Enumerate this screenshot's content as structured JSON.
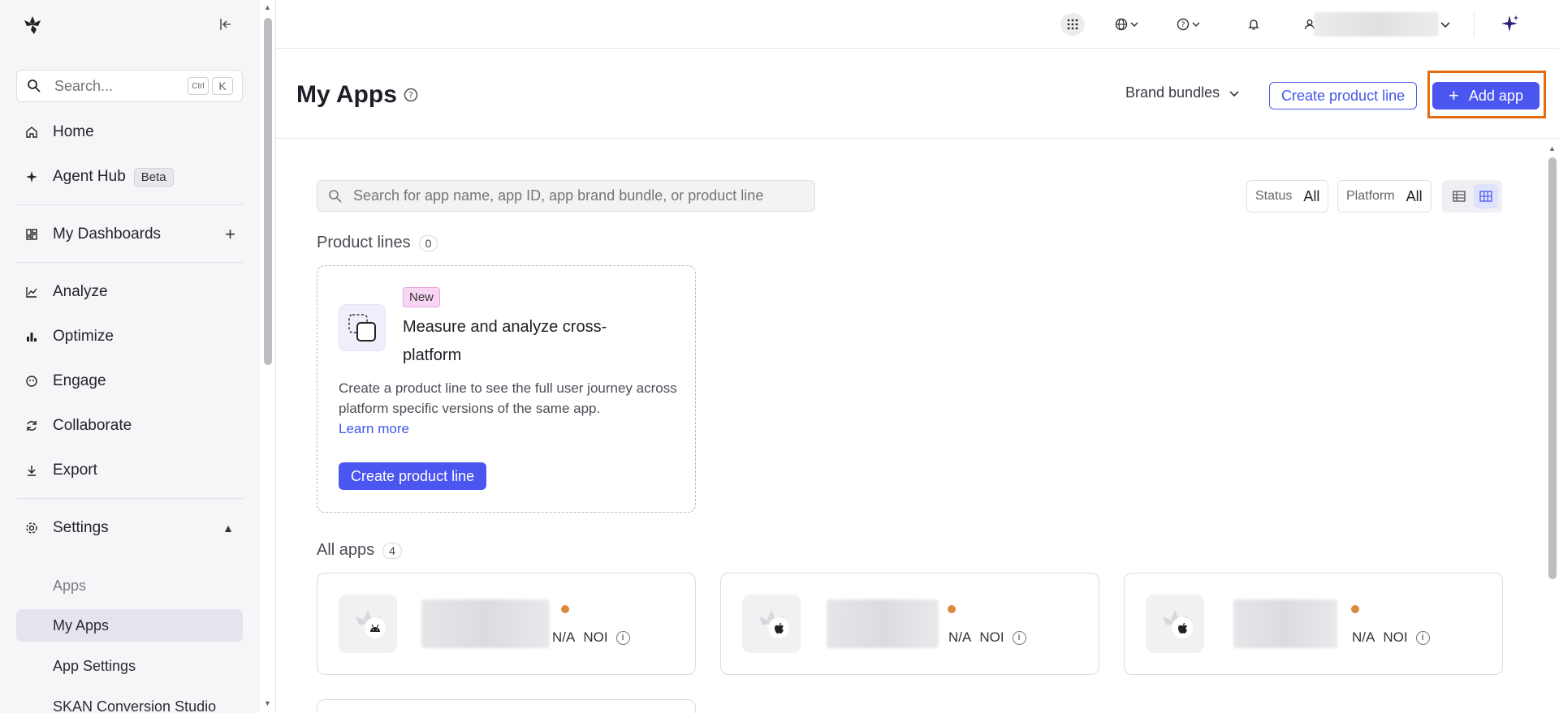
{
  "sidebar": {
    "search_placeholder": "Search...",
    "shortcut_ctrl": "Ctrl",
    "shortcut_k": "K",
    "items": {
      "home": "Home",
      "agent_hub": "Agent Hub",
      "agent_hub_badge": "Beta",
      "dashboards": "My Dashboards",
      "analyze": "Analyze",
      "optimize": "Optimize",
      "engage": "Engage",
      "collaborate": "Collaborate",
      "export": "Export",
      "settings": "Settings"
    },
    "settings_sub": {
      "header": "Apps",
      "my_apps": "My Apps",
      "app_settings": "App Settings",
      "skan": "SKAN Conversion Studio"
    }
  },
  "header": {
    "title": "My Apps",
    "brand_bundles": "Brand bundles",
    "create_product_line": "Create product line",
    "add_app": "Add app"
  },
  "content": {
    "search_placeholder": "Search for app name, app ID, app brand bundle, or product line",
    "filters": {
      "status_label": "Status",
      "status_value": "All",
      "platform_label": "Platform",
      "platform_value": "All"
    },
    "product_lines": {
      "title": "Product lines",
      "count": "0"
    },
    "promo": {
      "badge": "New",
      "title": "Measure and analyze cross-platform",
      "description": "Create a product line to see the full user journey across platform specific versions of the same app.",
      "link": "Learn more",
      "button": "Create product line"
    },
    "all_apps": {
      "title": "All apps",
      "count": "4"
    },
    "apps": [
      {
        "platform": "android-icon",
        "value": "N/A",
        "metric": "NOI"
      },
      {
        "platform": "apple-icon",
        "value": "N/A",
        "metric": "NOI"
      },
      {
        "platform": "apple-icon",
        "value": "N/A",
        "metric": "NOI"
      }
    ]
  },
  "colors": {
    "primary": "#4b55f0",
    "highlight": "#e66a10",
    "status_dot": "#d98a3c",
    "active_nav": "#e6e3ee"
  }
}
